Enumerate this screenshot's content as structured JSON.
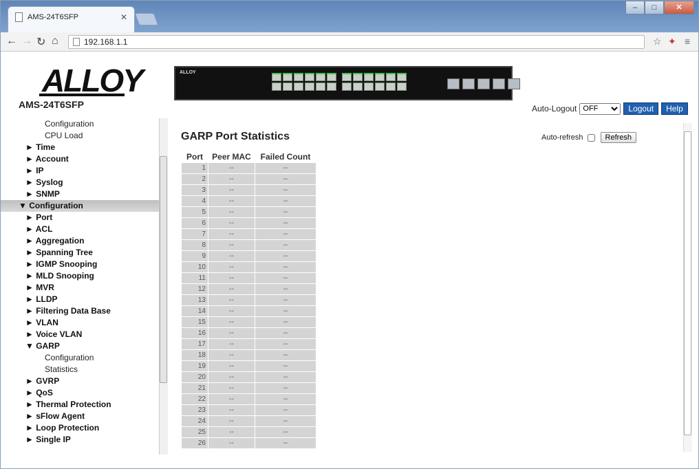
{
  "browser": {
    "tab_title": "AMS-24T6SFP",
    "url": "192.168.1.1"
  },
  "header": {
    "logo_text": "ALLOY",
    "model": "AMS-24T6SFP",
    "auto_logout_label": "Auto-Logout",
    "auto_logout_value": "OFF",
    "logout_label": "Logout",
    "help_label": "Help"
  },
  "sidebar": {
    "items": [
      {
        "label": "Configuration",
        "indent": 2,
        "bold": false
      },
      {
        "label": "CPU Load",
        "indent": 2,
        "bold": false
      },
      {
        "label": "► Time",
        "indent": 1,
        "bold": true
      },
      {
        "label": "► Account",
        "indent": 1,
        "bold": true
      },
      {
        "label": "► IP",
        "indent": 1,
        "bold": true
      },
      {
        "label": "► Syslog",
        "indent": 1,
        "bold": true
      },
      {
        "label": "► SNMP",
        "indent": 1,
        "bold": true
      },
      {
        "label": "▼ Configuration",
        "indent": 0,
        "bold": true,
        "selected": true
      },
      {
        "label": "► Port",
        "indent": 1,
        "bold": true
      },
      {
        "label": "► ACL",
        "indent": 1,
        "bold": true
      },
      {
        "label": "► Aggregation",
        "indent": 1,
        "bold": true
      },
      {
        "label": "► Spanning Tree",
        "indent": 1,
        "bold": true
      },
      {
        "label": "► IGMP Snooping",
        "indent": 1,
        "bold": true
      },
      {
        "label": "► MLD Snooping",
        "indent": 1,
        "bold": true
      },
      {
        "label": "► MVR",
        "indent": 1,
        "bold": true
      },
      {
        "label": "► LLDP",
        "indent": 1,
        "bold": true
      },
      {
        "label": "► Filtering Data Base",
        "indent": 1,
        "bold": true
      },
      {
        "label": "► VLAN",
        "indent": 1,
        "bold": true
      },
      {
        "label": "► Voice VLAN",
        "indent": 1,
        "bold": true
      },
      {
        "label": "▼ GARP",
        "indent": 1,
        "bold": true
      },
      {
        "label": "Configuration",
        "indent": 2,
        "bold": false
      },
      {
        "label": "Statistics",
        "indent": 2,
        "bold": false
      },
      {
        "label": "► GVRP",
        "indent": 1,
        "bold": true
      },
      {
        "label": "► QoS",
        "indent": 1,
        "bold": true
      },
      {
        "label": "► Thermal Protection",
        "indent": 1,
        "bold": true
      },
      {
        "label": "► sFlow Agent",
        "indent": 1,
        "bold": true
      },
      {
        "label": "► Loop Protection",
        "indent": 1,
        "bold": true
      },
      {
        "label": "► Single IP",
        "indent": 1,
        "bold": true
      }
    ]
  },
  "main": {
    "title": "GARP Port Statistics",
    "auto_refresh_label": "Auto-refresh",
    "refresh_label": "Refresh",
    "table": {
      "headers": [
        "Port",
        "Peer MAC",
        "Failed Count"
      ],
      "rows": [
        [
          "1",
          "--",
          "--"
        ],
        [
          "2",
          "--",
          "--"
        ],
        [
          "3",
          "--",
          "--"
        ],
        [
          "4",
          "--",
          "--"
        ],
        [
          "5",
          "--",
          "--"
        ],
        [
          "6",
          "--",
          "--"
        ],
        [
          "7",
          "--",
          "--"
        ],
        [
          "8",
          "--",
          "--"
        ],
        [
          "9",
          "--",
          "--"
        ],
        [
          "10",
          "--",
          "--"
        ],
        [
          "11",
          "--",
          "--"
        ],
        [
          "12",
          "--",
          "--"
        ],
        [
          "13",
          "--",
          "--"
        ],
        [
          "14",
          "--",
          "--"
        ],
        [
          "15",
          "--",
          "--"
        ],
        [
          "16",
          "--",
          "--"
        ],
        [
          "17",
          "--",
          "--"
        ],
        [
          "18",
          "--",
          "--"
        ],
        [
          "19",
          "--",
          "--"
        ],
        [
          "20",
          "--",
          "--"
        ],
        [
          "21",
          "--",
          "--"
        ],
        [
          "22",
          "--",
          "--"
        ],
        [
          "23",
          "--",
          "--"
        ],
        [
          "24",
          "--",
          "--"
        ],
        [
          "25",
          "--",
          "--"
        ],
        [
          "26",
          "--",
          "--"
        ]
      ]
    }
  },
  "colors": {
    "accent_button": "#2060b0",
    "sidebar_selected": "#c8c8c8",
    "table_cell": "#d4d4d4"
  }
}
